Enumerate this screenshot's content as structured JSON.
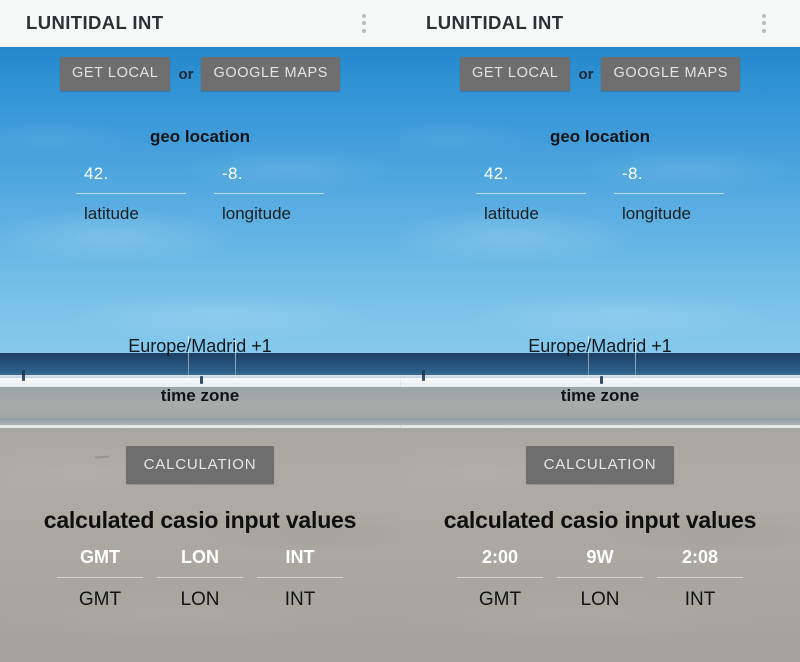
{
  "app": {
    "title": "LUNITIDAL INT",
    "overflow_icon": "more-vert-icon"
  },
  "actions": {
    "get_local": "GET LOCAL",
    "or": "or",
    "google_maps": "GOOGLE MAPS",
    "calculation": "CALCULATION"
  },
  "sections": {
    "geo_location": "geo location",
    "time_zone": "time zone",
    "results_title": "calculated casio input values"
  },
  "geo": {
    "latitude_value": "42.",
    "latitude_caption": "latitude",
    "longitude_value": "-8.",
    "longitude_caption": "longitude"
  },
  "timezone": {
    "value": "Europe/Madrid +1"
  },
  "results": {
    "captions": [
      "GMT",
      "LON",
      "INT"
    ],
    "before": [
      "GMT",
      "LON",
      "INT"
    ],
    "after": [
      "2:00",
      "9W",
      "2:08"
    ]
  },
  "colors": {
    "titlebar_bg": "#f7f8f8",
    "title_text": "#2e3133",
    "button_bg": "#6e6e6e",
    "button_text": "#e3e3e3",
    "sky_top": "#2487cd",
    "sky_bottom": "#86c9ec",
    "sea": "#24527d",
    "sand": "#a9a7a1",
    "value_text": "#ffffff",
    "label_text": "#101418"
  }
}
